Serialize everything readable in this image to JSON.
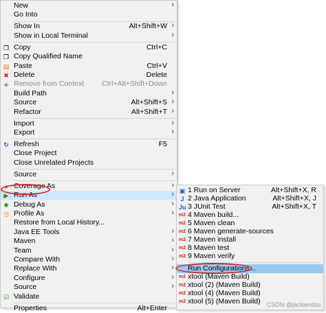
{
  "main_menu": [
    {
      "label": "New",
      "arrow": true
    },
    {
      "label": "Go Into"
    },
    {
      "sep": true
    },
    {
      "label": "Show In",
      "accel": "Alt+Shift+W",
      "arrow": true
    },
    {
      "label": "Show in Local Terminal",
      "arrow": true
    },
    {
      "sep": true
    },
    {
      "label": "Copy",
      "accel": "Ctrl+C",
      "icon": "copy-icon",
      "glyph": "❐"
    },
    {
      "label": "Copy Qualified Name",
      "icon": "copy-qualified-name-icon",
      "glyph": "❐"
    },
    {
      "label": "Paste",
      "accel": "Ctrl+V",
      "icon": "paste-icon",
      "glyph": "▤"
    },
    {
      "label": "Delete",
      "accel": "Delete",
      "icon": "delete-icon",
      "glyph": "✖"
    },
    {
      "label": "Remove from Context",
      "accel": "Ctrl+Alt+Shift+Down",
      "disabled": true,
      "icon": "remove-context-icon",
      "glyph": "◈"
    },
    {
      "label": "Build Path",
      "arrow": true
    },
    {
      "label": "Source",
      "accel": "Alt+Shift+S",
      "arrow": true
    },
    {
      "label": "Refactor",
      "accel": "Alt+Shift+T",
      "arrow": true
    },
    {
      "sep": true
    },
    {
      "label": "Import",
      "arrow": true
    },
    {
      "label": "Export",
      "arrow": true
    },
    {
      "sep": true
    },
    {
      "label": "Refresh",
      "accel": "F5",
      "icon": "refresh-icon",
      "glyph": "↻"
    },
    {
      "label": "Close Project"
    },
    {
      "label": "Close Unrelated Projects"
    },
    {
      "sep": true
    },
    {
      "label": "Source",
      "arrow": true
    },
    {
      "sep": true
    },
    {
      "label": "Coverage As",
      "arrow": true,
      "icon": "coverage-icon",
      "glyph": "●"
    },
    {
      "label": "Run As",
      "arrow": true,
      "highlight": true,
      "icon": "run-icon",
      "glyph": "▶"
    },
    {
      "label": "Debug As",
      "arrow": true,
      "icon": "debug-icon",
      "glyph": "✱"
    },
    {
      "label": "Profile As",
      "arrow": true,
      "icon": "profile-icon",
      "glyph": "◷"
    },
    {
      "label": "Restore from Local History..."
    },
    {
      "label": "Java EE Tools",
      "arrow": true
    },
    {
      "label": "Maven",
      "arrow": true
    },
    {
      "label": "Team",
      "arrow": true
    },
    {
      "label": "Compare With",
      "arrow": true
    },
    {
      "label": "Replace With",
      "arrow": true
    },
    {
      "label": "Configure",
      "arrow": true
    },
    {
      "label": "Source",
      "arrow": true
    },
    {
      "label": "Validate",
      "icon": "validate-icon",
      "glyph": "☑"
    },
    {
      "sep": true
    },
    {
      "label": "Properties",
      "accel": "Alt+Enter"
    }
  ],
  "sub_menu": [
    {
      "label": "1 Run on Server",
      "accel": "Alt+Shift+X, R",
      "icon": "server-icon",
      "glyph": "▣"
    },
    {
      "label": "2 Java Application",
      "accel": "Alt+Shift+X, J",
      "icon": "java-app-icon",
      "glyph": "J"
    },
    {
      "label": "3 JUnit Test",
      "accel": "Alt+Shift+X, T",
      "icon": "junit-icon",
      "glyph": "Ju"
    },
    {
      "label": "4 Maven build...",
      "icon": "maven-icon",
      "glyph": "m2"
    },
    {
      "label": "5 Maven clean",
      "icon": "maven-icon",
      "glyph": "m2"
    },
    {
      "label": "6 Maven generate-sources",
      "icon": "maven-icon",
      "glyph": "m2"
    },
    {
      "label": "7 Maven install",
      "icon": "maven-icon",
      "glyph": "m2"
    },
    {
      "label": "8 Maven test",
      "icon": "maven-icon",
      "glyph": "m2"
    },
    {
      "label": "9 Maven verify",
      "icon": "maven-icon",
      "glyph": "m2"
    },
    {
      "sep": true
    },
    {
      "label": "Run Configurations...",
      "highlight": true
    },
    {
      "label": "xtool (Maven Build)",
      "icon": "maven-icon",
      "glyph": "m2"
    },
    {
      "label": "xtool (2) (Maven Build)",
      "icon": "maven-icon",
      "glyph": "m2"
    },
    {
      "label": "xtool (4) (Maven Build)",
      "icon": "maven-icon",
      "glyph": "m2"
    },
    {
      "label": "xtool (5) (Maven Build)",
      "icon": "maven-icon",
      "glyph": "m2"
    }
  ],
  "watermark": "CSDN @jackiendsc",
  "colors": {
    "menu_bg": "#f0f0f0",
    "highlight": "#cce8ff",
    "annotation_red": "#d9262e"
  }
}
